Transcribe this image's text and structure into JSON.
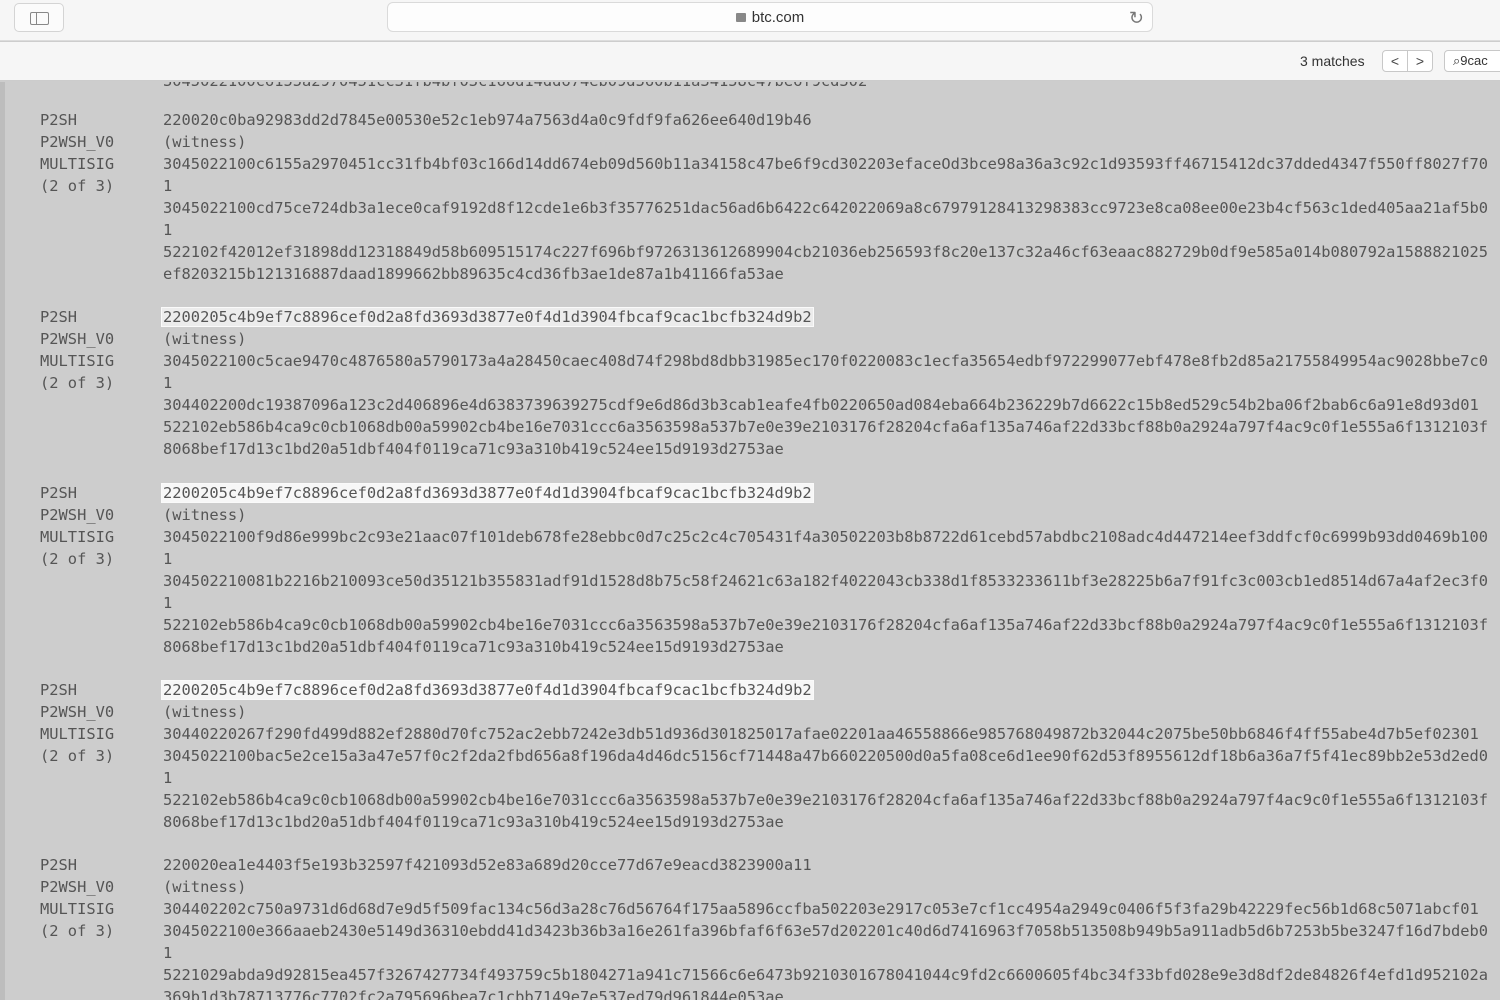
{
  "browser": {
    "url": "btc.com",
    "find": {
      "matches": "3 matches",
      "query": "9cac",
      "prev": "<",
      "next": ">"
    }
  },
  "cut_line": "3045022100c6155a2970451cc31fb4bf03c166d14dd674eb09d560b11a34158c47be6f9cd302",
  "blocks": [
    {
      "labels": [
        "P2SH",
        "P2WSH_V0",
        "MULTISIG",
        "(2 of 3)"
      ],
      "highlight": "none",
      "lines": [
        "220020c0ba92983dd2d7845e00530e52c1eb974a7563d4a0c9fdf9fa626ee640d19b46",
        "(witness)",
        "3045022100c6155a2970451cc31fb4bf03c166d14dd674eb09d560b11a34158c47be6f9cd302203efaceOd3bce98a36a3c92c1d93593ff46715412dc37dded4347f550ff8027f70",
        "1",
        "3045022100cd75ce724db3a1ece0caf9192d8f12cde1e6b3f35776251dac56ad6b6422c642022069a8c67979128413298383cc9723e8ca08ee00e23b4cf563c1ded405aa21af5b0",
        "1",
        "522102f42012ef31898dd12318849d58b609515174c227f696bf9726313612689904cb21036eb256593f8c20e137c32a46cf63eaac882729b0df9e585a014b080792a1588821025",
        "ef8203215b121316887daad1899662bb89635c4cd36fb3ae1de87a1b41166fa53ae"
      ]
    },
    {
      "labels": [
        "P2SH",
        "P2WSH_V0",
        "MULTISIG",
        "(2 of 3)"
      ],
      "highlight": "current",
      "lines": [
        "2200205c4b9ef7c8896cef0d2a8fd3693d3877e0f4d1d3904fbcaf9cac1bcfb324d9b2",
        "(witness)",
        "3045022100c5cae9470c4876580a5790173a4a28450caec408d74f298bd8dbb31985ec170f0220083c1ecfa35654edbf972299077ebf478e8fb2d85a21755849954ac9028bbe7c0",
        "1",
        "304402200dc19387096a123c2d406896e4d6383739639275cdf9e6d86d3b3cab1eafe4fb0220650ad084eba664b236229b7d6622c15b8ed529c54b2ba06f2bab6c6a91e8d93d01",
        "522102eb586b4ca9c0cb1068db00a59902cb4be16e7031ccc6a3563598a537b7e0e39e2103176f28204cfa6af135a746af22d33bcf88b0a2924a797f4ac9c0f1e555a6f1312103f",
        "8068bef17d13c1bd20a51dbf404f0119ca71c93a310b419c524ee15d9193d2753ae"
      ]
    },
    {
      "labels": [
        "P2SH",
        "P2WSH_V0",
        "MULTISIG",
        "(2 of 3)"
      ],
      "highlight": "match",
      "lines": [
        "2200205c4b9ef7c8896cef0d2a8fd3693d3877e0f4d1d3904fbcaf9cac1bcfb324d9b2",
        "(witness)",
        "3045022100f9d86e999bc2c93e21aac07f101deb678fe28ebbc0d7c25c2c4c705431f4a30502203b8b8722d61cebd57abdbc2108adc4d447214eef3ddfcf0c6999b93dd0469b100",
        "1",
        "304502210081b2216b210093ce50d35121b355831adf91d1528d8b75c58f24621c63a182f4022043cb338d1f8533233611bf3e28225b6a7f91fc3c003cb1ed8514d67a4af2ec3f0",
        "1",
        "522102eb586b4ca9c0cb1068db00a59902cb4be16e7031ccc6a3563598a537b7e0e39e2103176f28204cfa6af135a746af22d33bcf88b0a2924a797f4ac9c0f1e555a6f1312103f",
        "8068bef17d13c1bd20a51dbf404f0119ca71c93a310b419c524ee15d9193d2753ae"
      ]
    },
    {
      "labels": [
        "P2SH",
        "P2WSH_V0",
        "MULTISIG",
        "(2 of 3)"
      ],
      "highlight": "match",
      "lines": [
        "2200205c4b9ef7c8896cef0d2a8fd3693d3877e0f4d1d3904fbcaf9cac1bcfb324d9b2",
        "(witness)",
        "30440220267f290fd499d882ef2880d70fc752ac2ebb7242e3db51d936d301825017afae02201aa46558866e985768049872b32044c2075be50bb6846f4ff55abe4d7b5ef02301",
        "3045022100bac5e2ce15a3a47e57f0c2f2da2fbd656a8f196da4d46dc5156cf71448a47b660220500d0a5fa08ce6d1ee90f62d53f8955612df18b6a36a7f5f41ec89bb2e53d2ed0",
        "1",
        "522102eb586b4ca9c0cb1068db00a59902cb4be16e7031ccc6a3563598a537b7e0e39e2103176f28204cfa6af135a746af22d33bcf88b0a2924a797f4ac9c0f1e555a6f1312103f",
        "8068bef17d13c1bd20a51dbf404f0119ca71c93a310b419c524ee15d9193d2753ae"
      ]
    },
    {
      "labels": [
        "P2SH",
        "P2WSH_V0",
        "MULTISIG",
        "(2 of 3)"
      ],
      "highlight": "none",
      "lines": [
        "220020ea1e4403f5e193b32597f421093d52e83a689d20cce77d67e9eacd3823900a11",
        "(witness)",
        "304402202c750a9731d6d68d7e9d5f509fac134c56d3a28c76d56764f175aa5896ccfba502203e2917c053e7cf1cc4954a2949c0406f5f3fa29b42229fec56b1d68c5071abcf01",
        "3045022100e366aaeb2430e5149d36310ebdd41d3423b36b3a16e261fa396bfaf6f63e57d202201c40d6d7416963f7058b513508b949b5a911adb5d6b7253b5be3247f16d7bdeb0",
        "1",
        "5221029abda9d92815ea457f3267427734f493759c5b1804271a941c71566c6e6473b9210301678041044c9fd2c6600605f4bc34f33bfd028e9e3d8df2de84826f4efd1d952102a",
        "369b1d3b78713776c7702fc2a795696bea7c1cbb7149e7e537ed79d961844e053ae"
      ]
    }
  ]
}
